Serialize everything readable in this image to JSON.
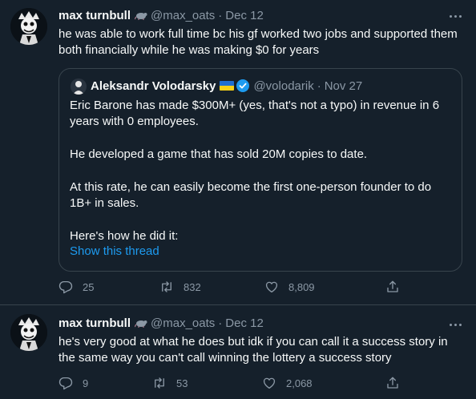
{
  "tweets": [
    {
      "author_name": "max turnbull",
      "author_emoji": "rat-emoji",
      "handle": "@max_oats",
      "separator": "·",
      "date": "Dec 12",
      "text": "he was able to work full time bc his gf worked two jobs and supported them both financially while he was making $0 for years",
      "quoted": {
        "author_name": "Aleksandr Volodarsky",
        "flag": "ukraine-flag",
        "verified": true,
        "handle": "@volodarik",
        "separator": "·",
        "date": "Nov 27",
        "paragraphs": [
          "Eric Barone has made $300M+ (yes, that's not a typo) in revenue in 6 years with 0 employees.",
          "He developed a game that has sold 20M copies to date.",
          "At this rate, he can easily become the first one-person founder to do 1B+ in sales.",
          "Here's how he did it:"
        ],
        "show_thread": "Show this thread"
      },
      "replies": "25",
      "retweets": "832",
      "likes": "8,809"
    },
    {
      "author_name": "max turnbull",
      "author_emoji": "rat-emoji",
      "handle": "@max_oats",
      "separator": "·",
      "date": "Dec 12",
      "text": "he's very good at what he does but idk if you can call it a success story in the same way you can't call winning the lottery a success story",
      "replies": "9",
      "retweets": "53",
      "likes": "2,068"
    }
  ],
  "colors": {
    "background": "#15202b",
    "text_primary": "#f7f9f9",
    "text_secondary": "#8b98a5",
    "border": "#38444d",
    "link": "#1d9bf0"
  }
}
